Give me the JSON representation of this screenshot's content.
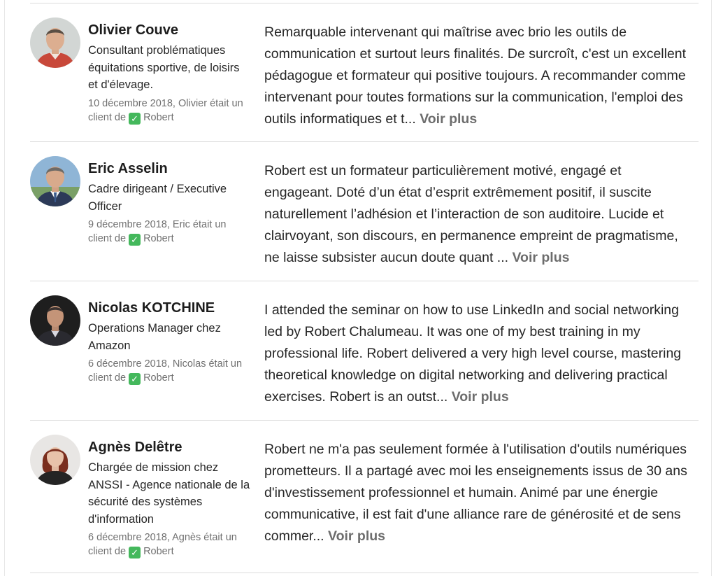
{
  "recommendations": [
    {
      "name": "Olivier Couve",
      "headline": "Consultant problématiques équitations sportive, de loisirs et d'élevage.",
      "meta_before": "10 décembre 2018, Olivier était un client de",
      "badge": "✓",
      "meta_after": "Robert",
      "text": "Remarquable intervenant qui maîtrise avec brio les outils de communication et surtout leurs finalités. De surcroît, c'est un excellent pédagogue et formateur qui positive toujours. A recommander comme intervenant pour toutes formations sur la communication, l'emploi des outils informatiques et t...",
      "more_label": "Voir plus"
    },
    {
      "name": "Eric Asselin",
      "headline": "Cadre dirigeant / Executive Officer",
      "meta_before": "9 décembre 2018, Eric était un client de",
      "badge": "✓",
      "meta_after": "Robert",
      "text": "Robert est un formateur particulièrement motivé, engagé et engageant. Doté d’un état d’esprit extrêmement positif, il suscite naturellement l’adhésion et l’interaction de son auditoire. Lucide et clairvoyant, son discours, en permanence empreint de pragmatisme, ne laisse subsister aucun doute quant ...",
      "more_label": "Voir plus"
    },
    {
      "name": "Nicolas KOTCHINE",
      "headline": "Operations Manager chez Amazon",
      "meta_before": "6 décembre 2018, Nicolas était un client de",
      "badge": "✓",
      "meta_after": "Robert",
      "text": "I attended the seminar on how to use LinkedIn and social networking led by Robert Chalumeau. It was one of my best training in my professional life. Robert delivered a very high level course, mastering theoretical knowledge on digital networking and delivering practical exercises. Robert is an outst...",
      "more_label": "Voir plus"
    },
    {
      "name": "Agnès Delêtre",
      "headline": "Chargée de mission chez ANSSI - Agence nationale de la sécurité des systèmes d'information",
      "meta_before": "6 décembre 2018, Agnès était un client de",
      "badge": "✓",
      "meta_after": "Robert",
      "text": "Robert ne m'a pas seulement formée à l'utilisation d'outils numériques prometteurs. Il a partagé avec moi les enseignements issus de 30 ans d'investissement professionnel et humain. Animé par une énergie communicative, il est fait d'une alliance rare de générosité et de sens commer...",
      "more_label": "Voir plus"
    }
  ],
  "colors": {
    "text": "#262626",
    "name": "#1d1d1d",
    "meta": "#707070",
    "more": "#6d6d6d",
    "check_badge": "#44b85c",
    "divider": "#dcdcdc"
  }
}
